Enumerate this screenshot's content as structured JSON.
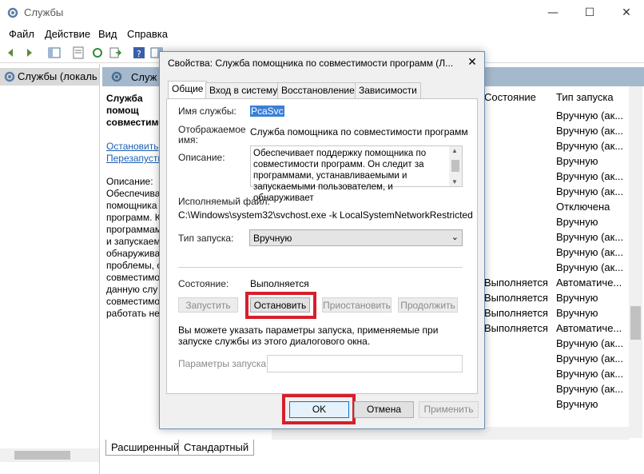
{
  "window": {
    "title": "Службы",
    "minimize": "—",
    "maximize": "☐",
    "close": "✕"
  },
  "menu": [
    "Файл",
    "Действие",
    "Вид",
    "Справка"
  ],
  "tree": {
    "root_label": "Службы (локалы"
  },
  "header": {
    "title": "Служ"
  },
  "left_panel": {
    "title_lines": [
      "Служба помощ",
      "совместимост"
    ],
    "link_stop": "Остановить",
    "link_restart": "Перезапусти",
    "description_lines": [
      "Описание:",
      "Обеспечива",
      "помощника",
      "программ. К",
      "программам",
      "и запускаем",
      "обнаружива",
      "проблемы, с",
      "совместимос",
      "данную слу",
      "совместимос",
      "работать не"
    ]
  },
  "columns": {
    "state": "Состояние",
    "startup": "Тип запуска"
  },
  "rows": [
    {
      "state": "",
      "startup": "Вручную (ак..."
    },
    {
      "state": "",
      "startup": "Вручную (ак..."
    },
    {
      "state": "",
      "startup": "Вручную (ак..."
    },
    {
      "state": "",
      "startup": "Вручную"
    },
    {
      "state": "",
      "startup": "Вручную (ак..."
    },
    {
      "state": "",
      "startup": "Вручную (ак..."
    },
    {
      "state": "",
      "startup": "Отключена"
    },
    {
      "state": "",
      "startup": "Вручную"
    },
    {
      "state": "",
      "startup": "Вручную (ак..."
    },
    {
      "state": "",
      "startup": "Вручную (ак..."
    },
    {
      "state": "",
      "startup": "Вручную (ак..."
    },
    {
      "state": "Выполняется",
      "startup": "Автоматиче..."
    },
    {
      "state": "Выполняется",
      "startup": "Вручную"
    },
    {
      "state": "Выполняется",
      "startup": "Вручную"
    },
    {
      "state": "Выполняется",
      "startup": "Автоматиче..."
    },
    {
      "state": "",
      "startup": "Вручную (ак..."
    },
    {
      "state": "",
      "startup": "Вручную (ак..."
    },
    {
      "state": "",
      "startup": "Вручную (ак..."
    },
    {
      "state": "",
      "startup": "Вручную (ак..."
    },
    {
      "state": "",
      "startup": "Вручную"
    }
  ],
  "bottom_tabs": {
    "extended": "Расширенный",
    "standard": "Стандартный"
  },
  "dialog": {
    "title": "Свойства: Служба помощника по совместимости программ (Л...",
    "close": "✕",
    "tabs": [
      "Общие",
      "Вход в систему",
      "Восстановление",
      "Зависимости"
    ],
    "service_name_label": "Имя службы:",
    "service_name_value": "PcaSvc",
    "display_name_label_1": "Отображаемое",
    "display_name_label_2": "имя:",
    "display_name_value": "Служба помощника по совместимости программ",
    "description_label": "Описание:",
    "description_text": "Обеспечивает поддержку помощника по совместимости программ. Он следит за программами, устанавливаемыми и запускаемыми пользователем, и обнаруживает",
    "exe_label": "Исполняемый файл:",
    "exe_path": "C:\\Windows\\system32\\svchost.exe -k LocalSystemNetworkRestricted",
    "startup_label": "Тип запуска:",
    "startup_value": "Вручную",
    "state_label": "Состояние:",
    "state_value": "Выполняется",
    "btn_start": "Запустить",
    "btn_stop": "Остановить",
    "btn_pause": "Приостановить",
    "btn_resume": "Продолжить",
    "hint": "Вы можете указать параметры запуска, применяемые при запуске службы из этого диалогового окна.",
    "params_label": "Параметры запуска:",
    "btn_ok": "OK",
    "btn_cancel": "Отмена",
    "btn_apply": "Применить"
  },
  "accent_colors": {
    "highlight": "#d61f2d",
    "selection": "#3b7fd6",
    "header": "#a5b9cc"
  }
}
